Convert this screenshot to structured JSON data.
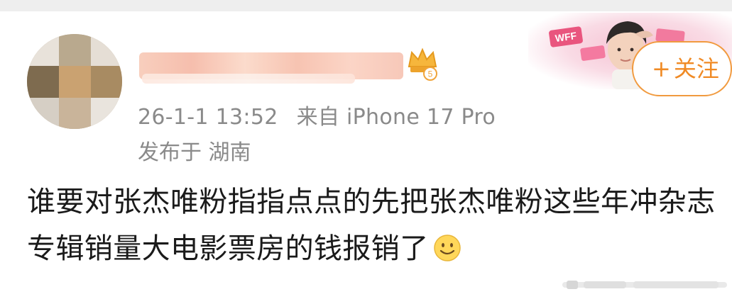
{
  "post": {
    "timestamp": "26-1-1 13:52",
    "source": "来自 iPhone 17 Pro",
    "location": "发布于 湖南",
    "text": "谁要对张杰唯粉指指点点的先把张杰唯粉这些年冲杂志专辑销量大电影票房的钱报销了",
    "emoji": "smile-emoji"
  },
  "follow_button": {
    "icon": "+",
    "label": "关注"
  },
  "banner": {
    "badge_text": "WFF"
  },
  "colors": {
    "accent": "#f08a24",
    "meta_text": "#8a8a8a",
    "body_text": "#1a1a1a"
  }
}
